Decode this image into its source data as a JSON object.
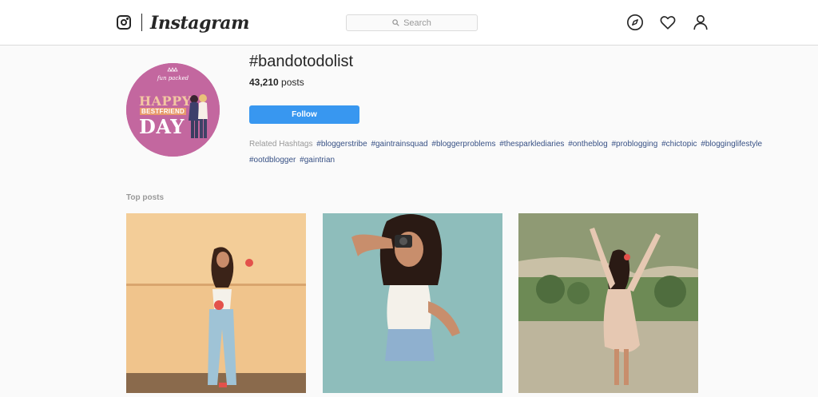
{
  "nav": {
    "brand": "Instagram",
    "search_placeholder": "Search",
    "icons": [
      "instagram-glyph-icon",
      "search-icon",
      "compass-icon",
      "heart-icon",
      "profile-icon"
    ]
  },
  "tag": {
    "title": "#bandotodolist",
    "post_count": "43,210",
    "post_count_suffix": " posts",
    "follow_label": "Follow",
    "avatar": {
      "brand": "fun packed",
      "line1": "HAPPY",
      "line2": "BESTFRIEND",
      "line3": "DAY"
    },
    "related_label": "Related Hashtags",
    "related_hashtags": [
      "#bloggerstribe",
      "#gaintrainsquad",
      "#bloggerproblems",
      "#thesparklediaries",
      "#ontheblog",
      "#problogging",
      "#chictopic",
      "#blogginglifestyle",
      "#ootdblogger",
      "#gaintrian"
    ]
  },
  "top_posts": {
    "label": "Top posts",
    "count": 3
  },
  "colors": {
    "accent": "#3897f0",
    "link": "#385185",
    "background": "#fafafa",
    "avatar_bg": "#c3679f"
  }
}
